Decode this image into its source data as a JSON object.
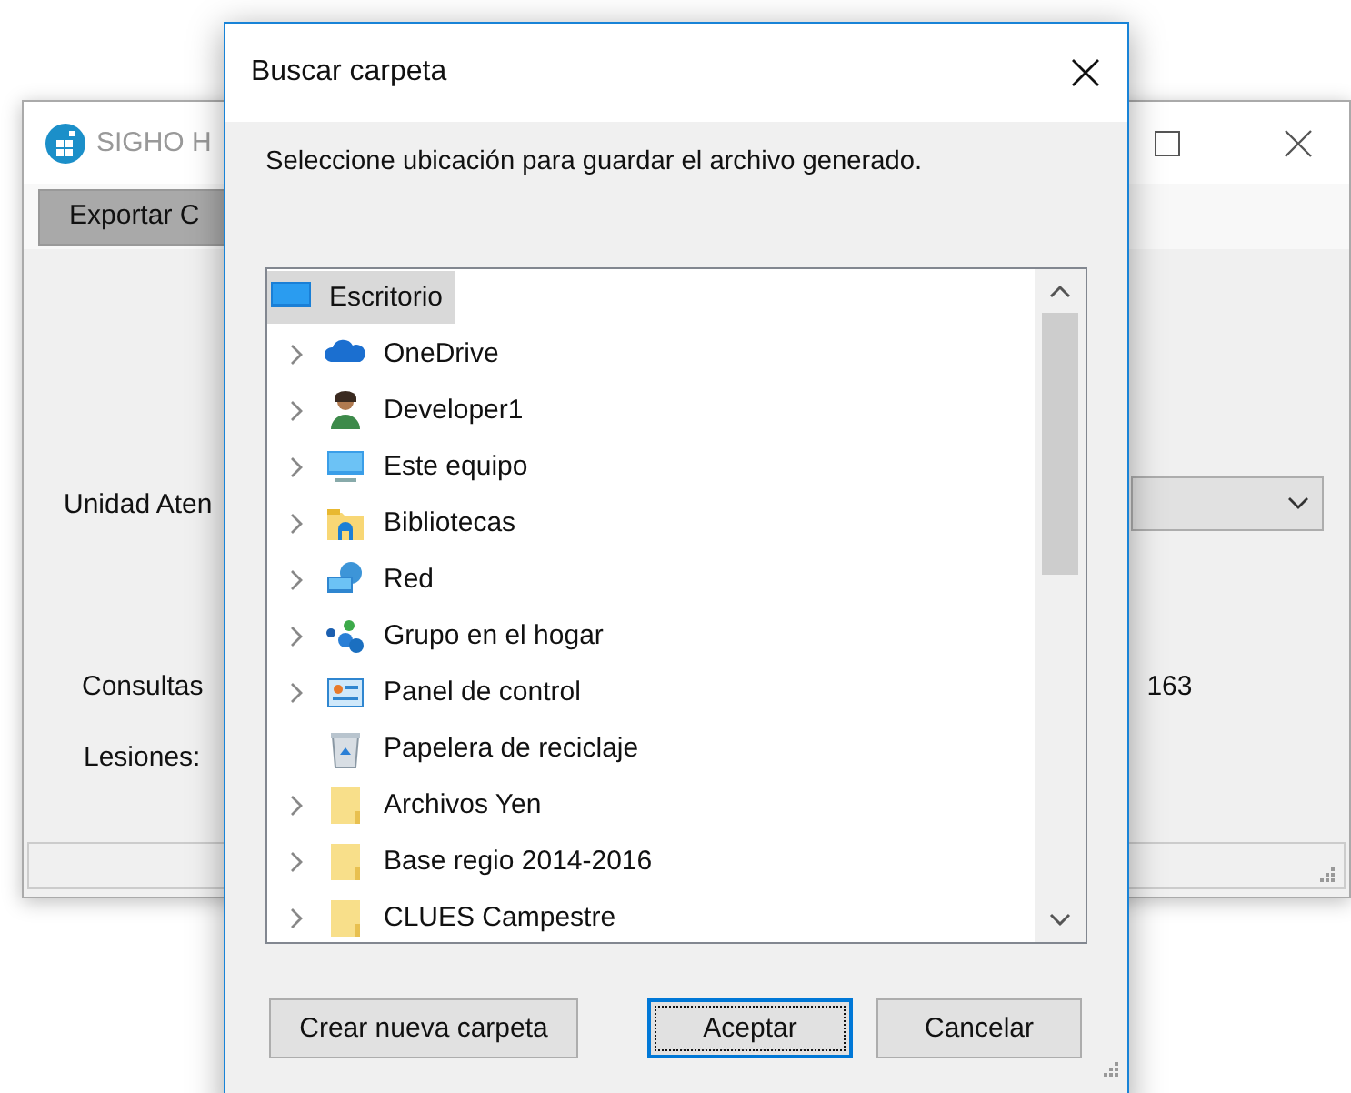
{
  "back_window": {
    "title": "SIGHO H",
    "tab": "Exportar C",
    "labels": [
      {
        "kind": "unidad",
        "text": "Unidad Aten"
      },
      {
        "kind": "consultas",
        "text": "Consultas"
      },
      {
        "kind": "lesiones",
        "text": "Lesiones:"
      }
    ],
    "value": "163"
  },
  "dialog": {
    "title": "Buscar carpeta",
    "instruction": "Seleccione ubicación para guardar el archivo generado.",
    "tree": [
      {
        "label": "Escritorio",
        "kind": "desktop",
        "selected": true,
        "expandable": false,
        "children": [
          {
            "label": "OneDrive",
            "kind": "cloud",
            "selected": false,
            "expandable": true
          },
          {
            "label": "Developer1",
            "kind": "user",
            "selected": false,
            "expandable": true
          },
          {
            "label": "Este equipo",
            "kind": "monitor",
            "selected": false,
            "expandable": true
          },
          {
            "label": "Bibliotecas",
            "kind": "library",
            "selected": false,
            "expandable": true
          },
          {
            "label": "Red",
            "kind": "network",
            "selected": false,
            "expandable": true
          },
          {
            "label": "Grupo en el hogar",
            "kind": "homegroup",
            "selected": false,
            "expandable": true
          },
          {
            "label": "Panel de control",
            "kind": "control",
            "selected": false,
            "expandable": true
          },
          {
            "label": "Papelera de reciclaje",
            "kind": "bin",
            "selected": false,
            "expandable": false
          },
          {
            "label": "Archivos Yen",
            "kind": "folder",
            "selected": false,
            "expandable": true
          },
          {
            "label": "Base regio 2014-2016",
            "kind": "folder",
            "selected": false,
            "expandable": true
          },
          {
            "label": "CLUES Campestre",
            "kind": "folder",
            "selected": false,
            "expandable": true
          }
        ]
      }
    ],
    "buttons": [
      {
        "label": "Crear nueva carpeta",
        "selected": false
      },
      {
        "label": "Aceptar",
        "selected": true
      },
      {
        "label": "Cancelar",
        "selected": false
      }
    ]
  }
}
